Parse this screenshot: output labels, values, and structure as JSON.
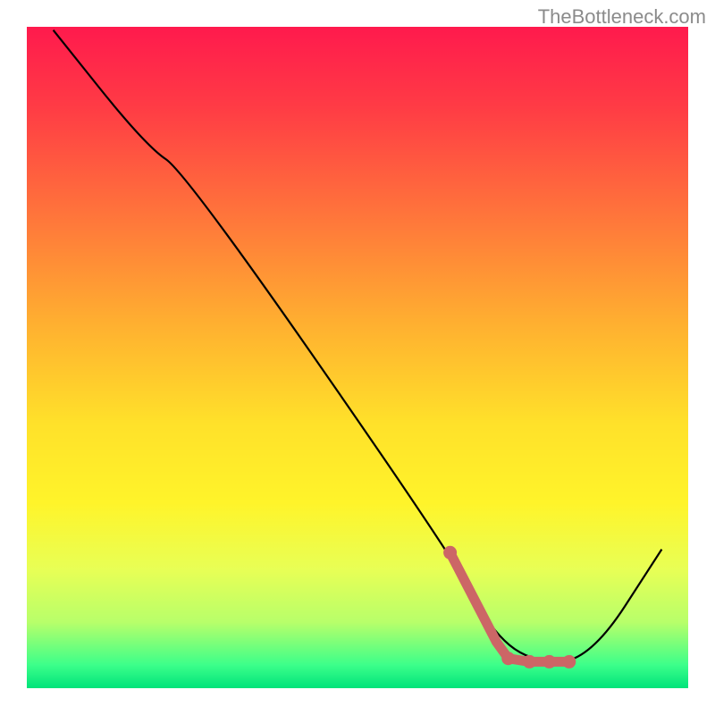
{
  "watermark": "TheBottleneck.com",
  "chart_data": {
    "type": "line",
    "title": "",
    "xlabel": "",
    "ylabel": "",
    "xlim": [
      0,
      100
    ],
    "ylim": [
      0,
      100
    ],
    "gradient_stops": [
      {
        "offset": 0.0,
        "color": "#ff1a4d"
      },
      {
        "offset": 0.12,
        "color": "#ff3b45"
      },
      {
        "offset": 0.3,
        "color": "#ff7a3a"
      },
      {
        "offset": 0.45,
        "color": "#ffb030"
      },
      {
        "offset": 0.6,
        "color": "#ffe12a"
      },
      {
        "offset": 0.72,
        "color": "#fff42a"
      },
      {
        "offset": 0.82,
        "color": "#e8ff55"
      },
      {
        "offset": 0.9,
        "color": "#b8ff6a"
      },
      {
        "offset": 0.965,
        "color": "#3cff8a"
      },
      {
        "offset": 1.0,
        "color": "#00e37a"
      }
    ],
    "series": [
      {
        "name": "bottleneck-curve",
        "stroke": "#000000",
        "points": [
          {
            "x": 4.0,
            "y": 99.5
          },
          {
            "x": 18.0,
            "y": 82.0
          },
          {
            "x": 24.0,
            "y": 78.0
          },
          {
            "x": 65.0,
            "y": 19.0
          },
          {
            "x": 70.0,
            "y": 9.0
          },
          {
            "x": 76.0,
            "y": 4.0
          },
          {
            "x": 85.0,
            "y": 4.0
          },
          {
            "x": 96.0,
            "y": 21.0
          }
        ]
      },
      {
        "name": "highlight-segment",
        "stroke": "#cc6666",
        "points": [
          {
            "x": 64.0,
            "y": 20.5
          },
          {
            "x": 71.0,
            "y": 7.0
          },
          {
            "x": 72.8,
            "y": 4.5
          },
          {
            "x": 76.0,
            "y": 4.0
          },
          {
            "x": 79.0,
            "y": 4.0
          },
          {
            "x": 82.0,
            "y": 4.0
          }
        ],
        "dots": [
          {
            "x": 64.0,
            "y": 20.5
          },
          {
            "x": 72.8,
            "y": 4.5
          },
          {
            "x": 76.0,
            "y": 4.0
          },
          {
            "x": 79.0,
            "y": 4.0
          },
          {
            "x": 82.0,
            "y": 4.0
          }
        ]
      }
    ]
  }
}
